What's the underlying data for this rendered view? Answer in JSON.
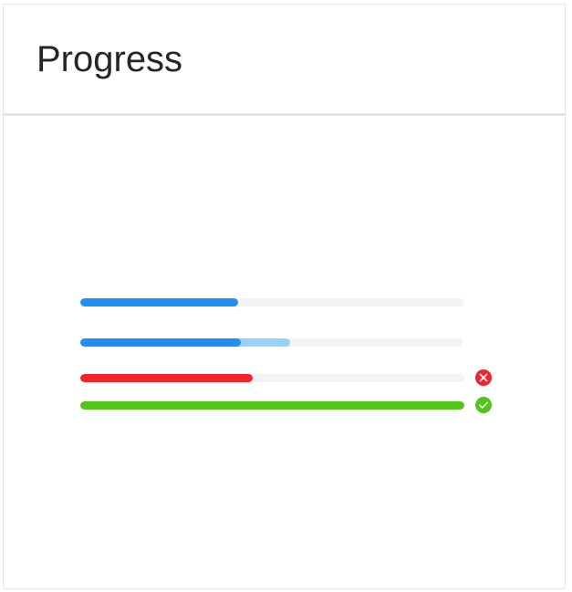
{
  "header": {
    "title": "Progress"
  },
  "colors": {
    "track": "#f3f3f3",
    "primary": "#1f8ff6",
    "secondary": "#97d2fb",
    "exception": "#f5222d",
    "success": "#52c41a"
  },
  "progress_bars": [
    {
      "status": "normal",
      "percent": 41,
      "icon": ""
    },
    {
      "status": "active",
      "percent": 42,
      "secondary_percent": 55,
      "icon": ""
    },
    {
      "status": "exception",
      "percent": 45,
      "icon": "close-circle-icon"
    },
    {
      "status": "success",
      "percent": 100,
      "icon": "check-circle-icon"
    }
  ]
}
